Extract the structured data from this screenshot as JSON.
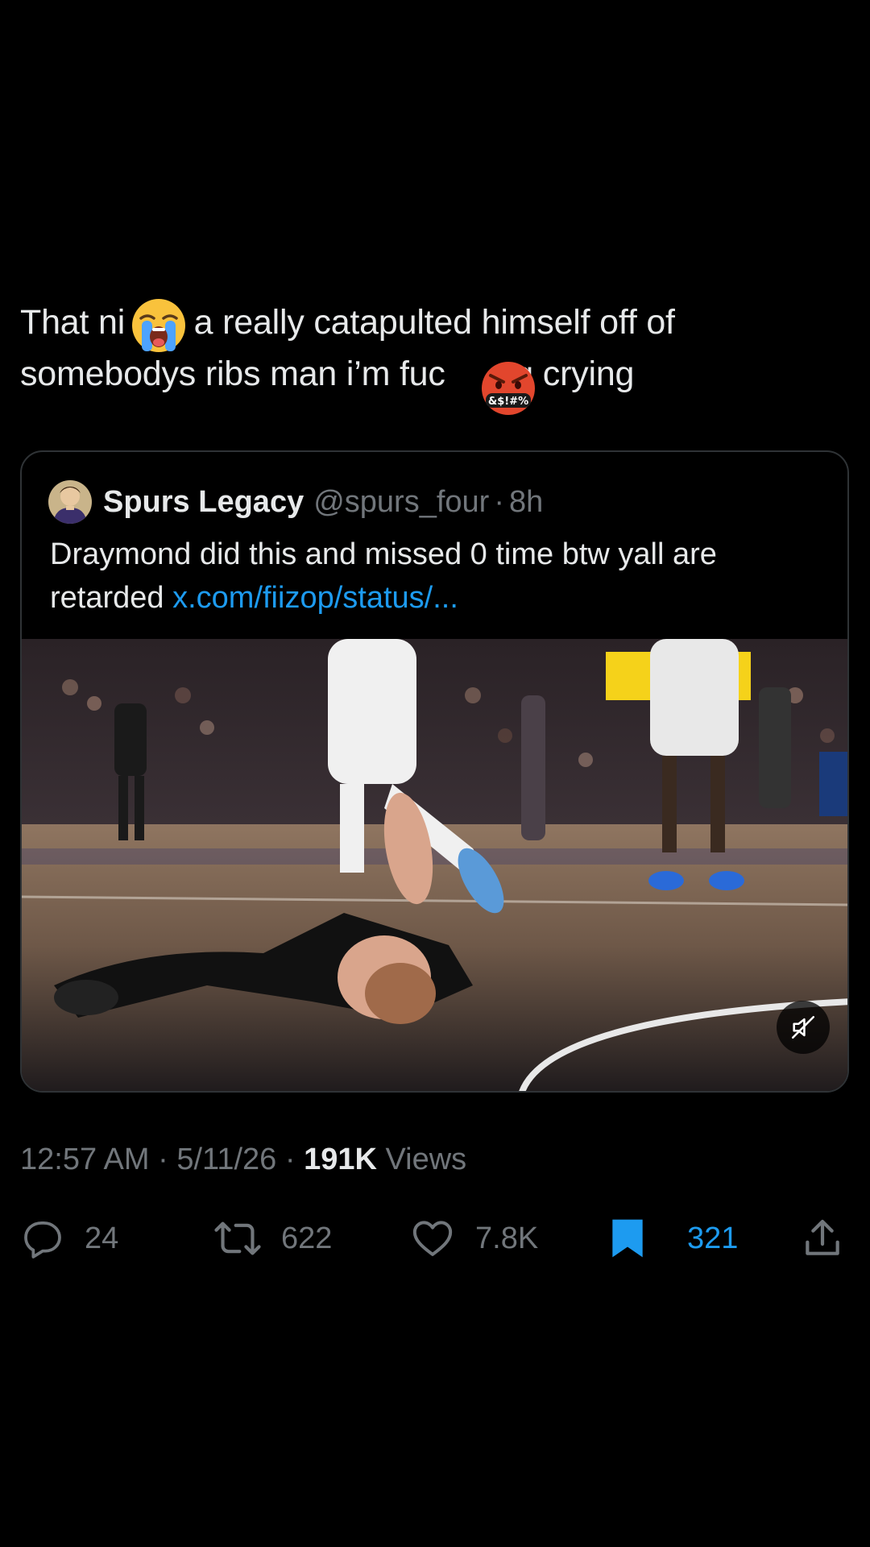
{
  "tweet": {
    "text_line1": "That ni  a really catapulted himself off of",
    "text_line2": "somebodys ribs man i’m fuc  g crying"
  },
  "quote": {
    "name": "Spurs Legacy",
    "handle": "@spurs_four",
    "separator": "·",
    "time": "8h",
    "text_line1": "Draymond did this and missed 0 time btw yall are",
    "text_line2_prefix": "retarded ",
    "link_text": "x.com/fiizop/status/...",
    "media_icon": "mute-icon"
  },
  "meta": {
    "time": "12:57 AM",
    "sep1": "·",
    "date": "5/11/26",
    "sep2": "·",
    "views_count": "191K",
    "views_label": "Views"
  },
  "actions": {
    "replies": "24",
    "reposts": "622",
    "likes": "7.8K",
    "bookmarks": "321"
  },
  "colors": {
    "background": "#000000",
    "text": "#e7e9ea",
    "muted": "#71767b",
    "accent": "#1d9bf0",
    "border": "#2f3336"
  }
}
